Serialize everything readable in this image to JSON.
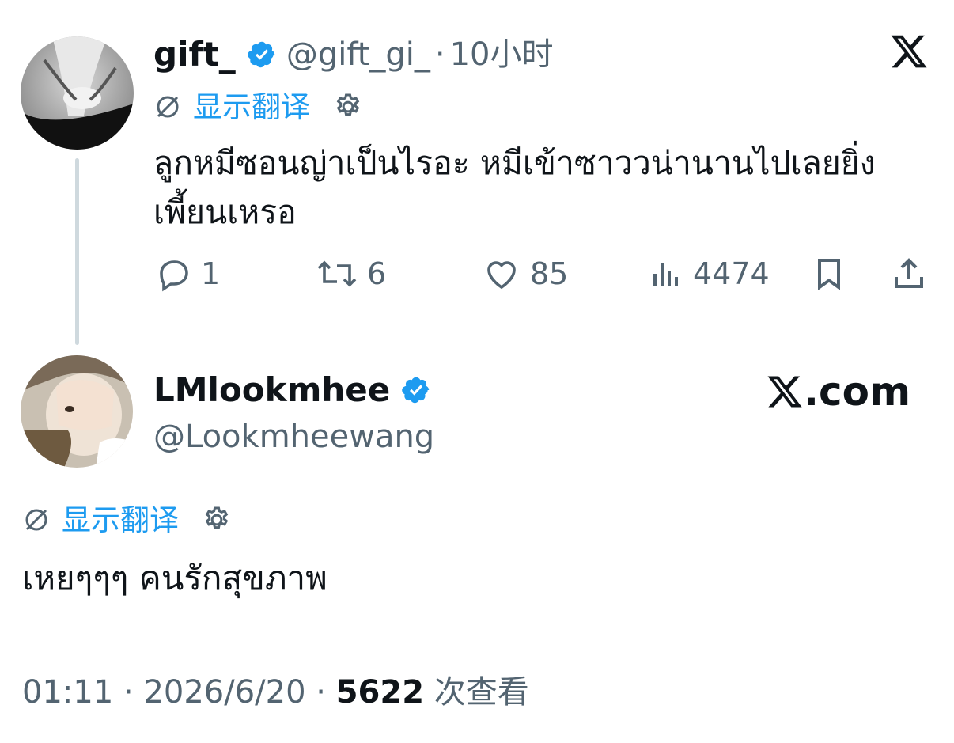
{
  "parent_tweet": {
    "display_name": "gift_",
    "handle": "@gift_gi_",
    "separator": "·",
    "time_ago": "10小时",
    "translate_label": "显示翻译",
    "text": "ลูกหมีซอนญ่าเป็นไรอะ หมีเข้าซาววน่านานไปเลยยิ่งเพี้ยนเหรอ",
    "replies": "1",
    "retweets": "6",
    "likes": "85",
    "views": "4474"
  },
  "reply_tweet": {
    "display_name": "LMlookmhee",
    "handle": "@Lookmheewang",
    "translate_label": "显示翻译",
    "text": "เหยๆๆๆ คนรักสุขภาพ",
    "time": "01:11",
    "date": "2026/6/20",
    "views_count": "5622",
    "views_label": "次查看"
  },
  "watermark": {
    "x_logo_text": "𝕏",
    "brand_text": ".com"
  },
  "icons": {
    "verified": "verified-badge-icon",
    "translate": "no-translate-icon",
    "settings": "gear-icon",
    "reply": "comment-icon",
    "retweet": "retweet-icon",
    "like": "heart-icon",
    "views": "bar-chart-icon",
    "bookmark": "bookmark-icon",
    "share": "share-icon"
  },
  "colors": {
    "accent": "#1d9bf0",
    "muted": "#536471",
    "text": "#0f1419"
  }
}
